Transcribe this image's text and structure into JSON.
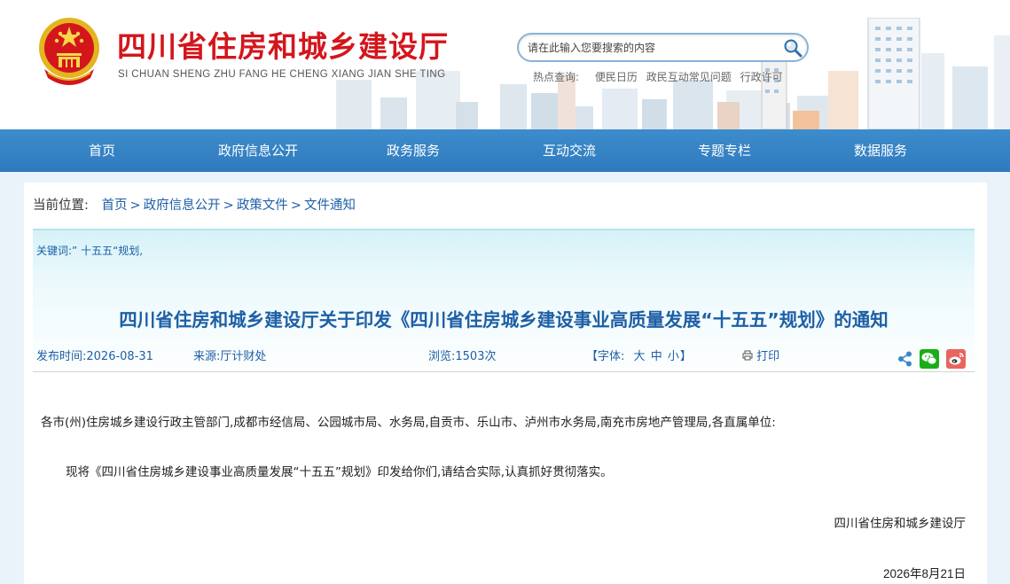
{
  "header": {
    "site_title": "四川省住房和城乡建设厅",
    "site_subtitle": "SI CHUAN SHENG ZHU FANG HE CHENG XIANG JIAN SHE TING",
    "search_placeholder": "请在此输入您要搜索的内容",
    "hot_label": "热点查询:",
    "hot_links": [
      "便民日历",
      "政民互动常见问题",
      "行政许可"
    ]
  },
  "nav": {
    "items": [
      "首页",
      "政府信息公开",
      "政务服务",
      "互动交流",
      "专题专栏",
      "数据服务"
    ]
  },
  "breadcrumb": {
    "label": "当前位置:",
    "items": [
      "首页",
      "政府信息公开",
      "政策文件",
      "文件通知"
    ],
    "separator": ">"
  },
  "article": {
    "keywords": "关键词:” 十五五“规划,",
    "title": "四川省住房和城乡建设厅关于印发《四川省住房城乡建设事业高质量发展“十五五”规划》的通知",
    "publish_label": "发布时间:",
    "publish_date": "2026-08-31",
    "source_label": "来源:",
    "source": "厅计财处",
    "views_label": "浏览:",
    "views": "1503次",
    "font_label_open": "【字体:",
    "font_sizes": [
      "大",
      "中",
      "小"
    ],
    "font_label_close": "】",
    "print_label": "打印",
    "share_icons": [
      "share-icon",
      "wechat-icon",
      "weibo-icon"
    ],
    "salutation": "各市(州)住房城乡建设行政主管部门,成都市经信局、公园城市局、水务局,自贡市、乐山市、泸州市水务局,南充市房地产管理局,各直属单位:",
    "paragraph": "现将《四川省住房城乡建设事业高质量发展“十五五”规划》印发给你们,请结合实际,认真抓好贯彻落实。",
    "signature": "四川省住房和城乡建设厅",
    "date": "2026年8月21日"
  },
  "colors": {
    "brand_red": "#d3161c",
    "nav_blue": "#3a87c9",
    "link_blue": "#1d5fa6",
    "wechat_green": "#1aad19",
    "weibo_red": "#e6162d"
  }
}
